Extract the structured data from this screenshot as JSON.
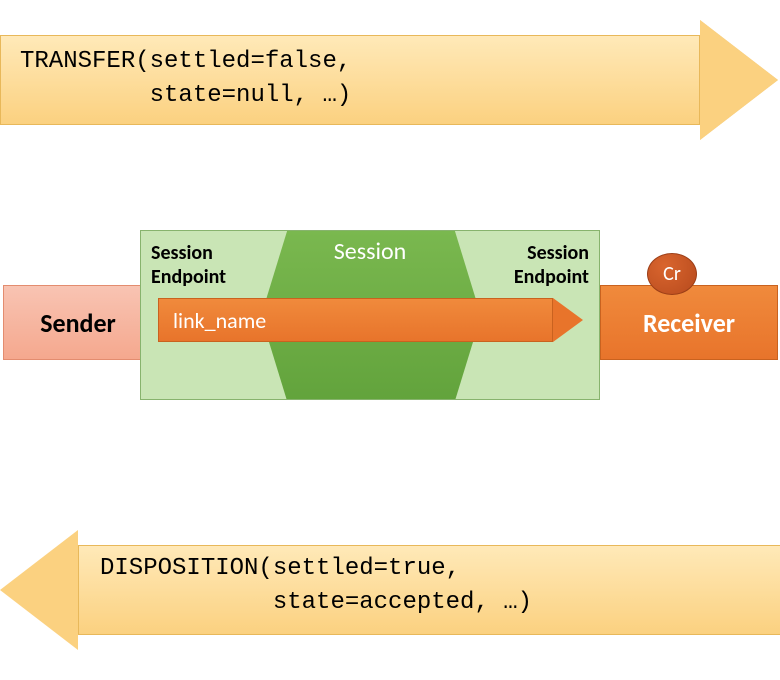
{
  "top_arrow": {
    "line1": "TRANSFER(settled=false,",
    "line2": "         state=null, …)"
  },
  "bottom_arrow": {
    "line1": "DISPOSITION(settled=true,",
    "line2": "            state=accepted, …)"
  },
  "middle": {
    "sender_label": "Sender",
    "receiver_label": "Receiver",
    "session_title": "Session",
    "session_endpoint_left_l1": "Session",
    "session_endpoint_left_l2": "Endpoint",
    "session_endpoint_right_l1": "Session",
    "session_endpoint_right_l2": "Endpoint",
    "link_name_label": "link_name",
    "cr_badge": "Cr"
  },
  "colors": {
    "arrow_fill_top": "#ffe9b8",
    "arrow_fill_bottom": "#fbd180",
    "arrow_border": "#e8b85a",
    "sender_fill": "#f5a88e",
    "receiver_fill": "#e8742b",
    "session_light": "#c9e5b5",
    "session_dark": "#62a33c",
    "link_fill": "#e8742b",
    "cr_fill": "#b74a1d"
  }
}
